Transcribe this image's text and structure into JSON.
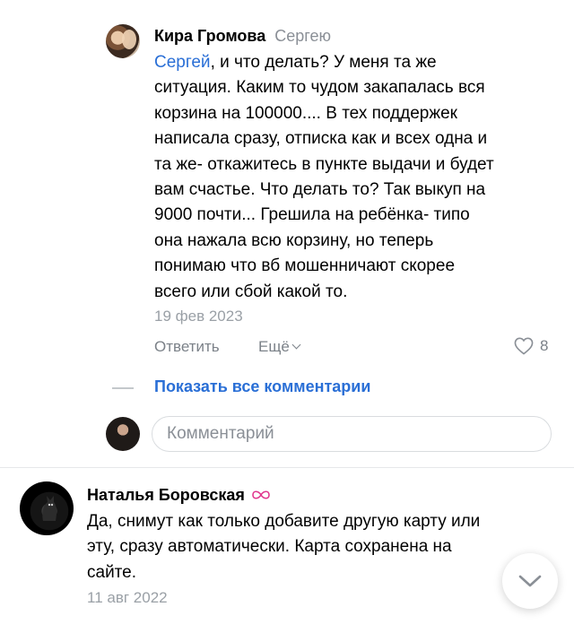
{
  "reply": {
    "author": "Кира Громова",
    "reply_to": "Сергею",
    "mention": "Сергей",
    "text_lines": [
      ", и что делать? У меня та же",
      "ситуация. Каким то чудом закапалась вся",
      "корзина на 100000.... В тех поддержек",
      "написала сразу, отписка как и всех одна и",
      "та же- откажитесь в пункте выдачи и будет",
      "вам счастье. Что делать то? Так выкуп на",
      "9000 почти... Грешила на ребёнка- типо",
      "она нажала всю корзину, но теперь",
      "понимаю что вб мошенничают скорее",
      "всего или сбой какой то."
    ],
    "date": "19 фев 2023",
    "reply_button": "Ответить",
    "more_button": "Ещё",
    "likes": "8"
  },
  "thread": {
    "show_all": "Показать все комментарии",
    "comment_placeholder": "Комментарий"
  },
  "comment": {
    "author": "Наталья Боровская",
    "text_lines": [
      "Да, снимут как только добавите другую карту или",
      "эту, сразу автоматически. Карта сохранена на",
      "сайте."
    ],
    "date": "11 авг 2022"
  },
  "colors": {
    "link": "#2a6fd6",
    "badge": "#e0378e",
    "muted": "#8a8f96"
  }
}
